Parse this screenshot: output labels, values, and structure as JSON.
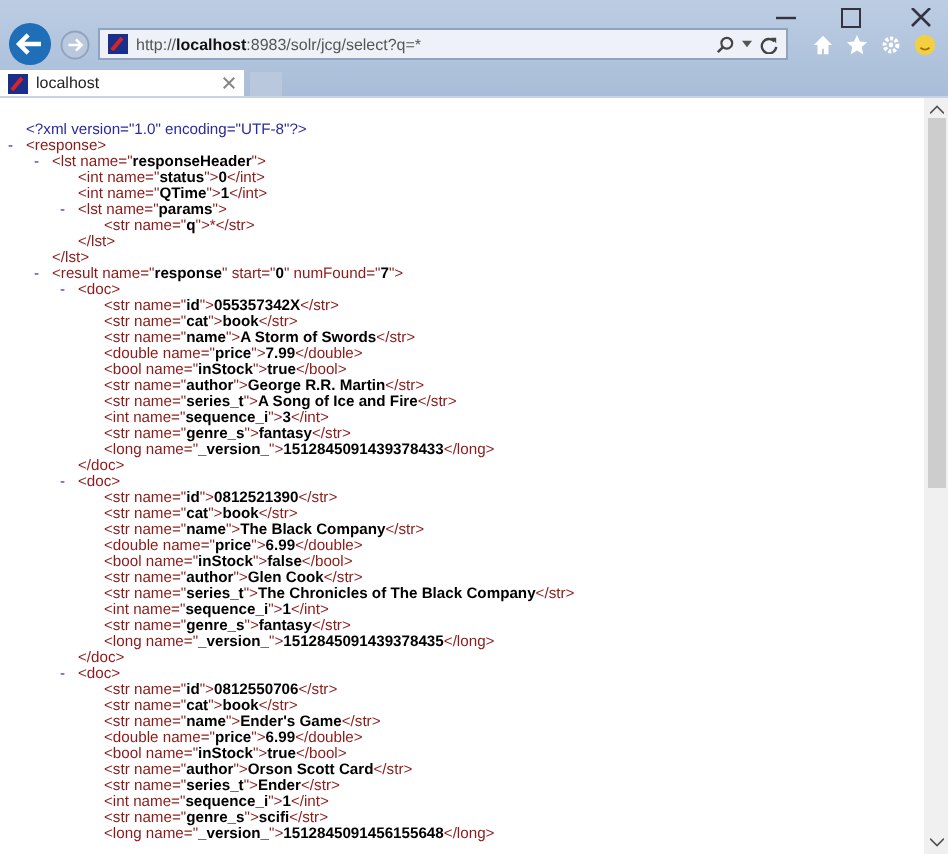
{
  "browser": {
    "address": "http://**localhost**:8983/solr/jcg/select?q=*"
  },
  "tabs": [
    {
      "label": "localhost",
      "selected": true
    }
  ],
  "document": {
    "declaration": "<?xml version=\"1.0\" encoding=\"UTF-8\"?>",
    "root": {
      "toggle": "-",
      "open": "<response>",
      "expanded": true,
      "children": [
        {
          "toggle": "-",
          "open": "<lst name=\"**responseHeader**\">",
          "expanded": true,
          "close": "</lst>",
          "children": [
            {
              "line": "<int name=\"**status**\">**0**</int>"
            },
            {
              "line": "<int name=\"**QTime**\">**1**</int>"
            },
            {
              "toggle": "-",
              "open": "<lst name=\"**params**\">",
              "expanded": true,
              "close": "</lst>",
              "children": [
                {
                  "line": "<str name=\"**q**\">*</str>"
                }
              ]
            }
          ]
        },
        {
          "toggle": "-",
          "open": "<result name=\"**response**\" start=\"**0**\" numFound=\"**7**\">",
          "expanded": true,
          "children": [
            {
              "toggle": "-",
              "open": "<doc>",
              "expanded": true,
              "close": "</doc>",
              "children": [
                {
                  "line": "<str name=\"**id**\">**055357342X**</str>"
                },
                {
                  "line": "<str name=\"**cat**\">**book**</str>"
                },
                {
                  "line": "<str name=\"**name**\">**A Storm of Swords**</str>"
                },
                {
                  "line": "<double name=\"**price**\">**7.99**</double>"
                },
                {
                  "line": "<bool name=\"**inStock**\">**true**</bool>"
                },
                {
                  "line": "<str name=\"**author**\">**George R.R. Martin**</str>"
                },
                {
                  "line": "<str name=\"**series_t**\">**A Song of Ice and Fire**</str>"
                },
                {
                  "line": "<int name=\"**sequence_i**\">**3**</int>"
                },
                {
                  "line": "<str name=\"**genre_s**\">**fantasy**</str>"
                },
                {
                  "line": "<long name=\"**_version_**\">**1512845091439378433**</long>"
                }
              ]
            },
            {
              "toggle": "-",
              "open": "<doc>",
              "expanded": true,
              "close": "</doc>",
              "children": [
                {
                  "line": "<str name=\"**id**\">**0812521390**</str>"
                },
                {
                  "line": "<str name=\"**cat**\">**book**</str>"
                },
                {
                  "line": "<str name=\"**name**\">**The Black Company**</str>"
                },
                {
                  "line": "<double name=\"**price**\">**6.99**</double>"
                },
                {
                  "line": "<bool name=\"**inStock**\">**false**</bool>"
                },
                {
                  "line": "<str name=\"**author**\">**Glen Cook**</str>"
                },
                {
                  "line": "<str name=\"**series_t**\">**The Chronicles of The Black Company**</str>"
                },
                {
                  "line": "<int name=\"**sequence_i**\">**1**</int>"
                },
                {
                  "line": "<str name=\"**genre_s**\">**fantasy**</str>"
                },
                {
                  "line": "<long name=\"**_version_**\">**1512845091439378435**</long>"
                }
              ]
            },
            {
              "toggle": "-",
              "open": "<doc>",
              "expanded": true,
              "children": [
                {
                  "line": "<str name=\"**id**\">**0812550706**</str>"
                },
                {
                  "line": "<str name=\"**cat**\">**book**</str>"
                },
                {
                  "line": "<str name=\"**name**\">**Ender's Game**</str>"
                },
                {
                  "line": "<double name=\"**price**\">**6.99**</double>"
                },
                {
                  "line": "<bool name=\"**inStock**\">**true**</bool>"
                },
                {
                  "line": "<str name=\"**author**\">**Orson Scott Card**</str>"
                },
                {
                  "line": "<str name=\"**series_t**\">**Ender**</str>"
                },
                {
                  "line": "<int name=\"**sequence_i**\">**1**</int>"
                },
                {
                  "line": "<str name=\"**genre_s**\">**scifi**</str>"
                },
                {
                  "line": "<long name=\"**_version_**\">**1512845091456155648**</long>"
                }
              ]
            }
          ]
        }
      ]
    }
  }
}
